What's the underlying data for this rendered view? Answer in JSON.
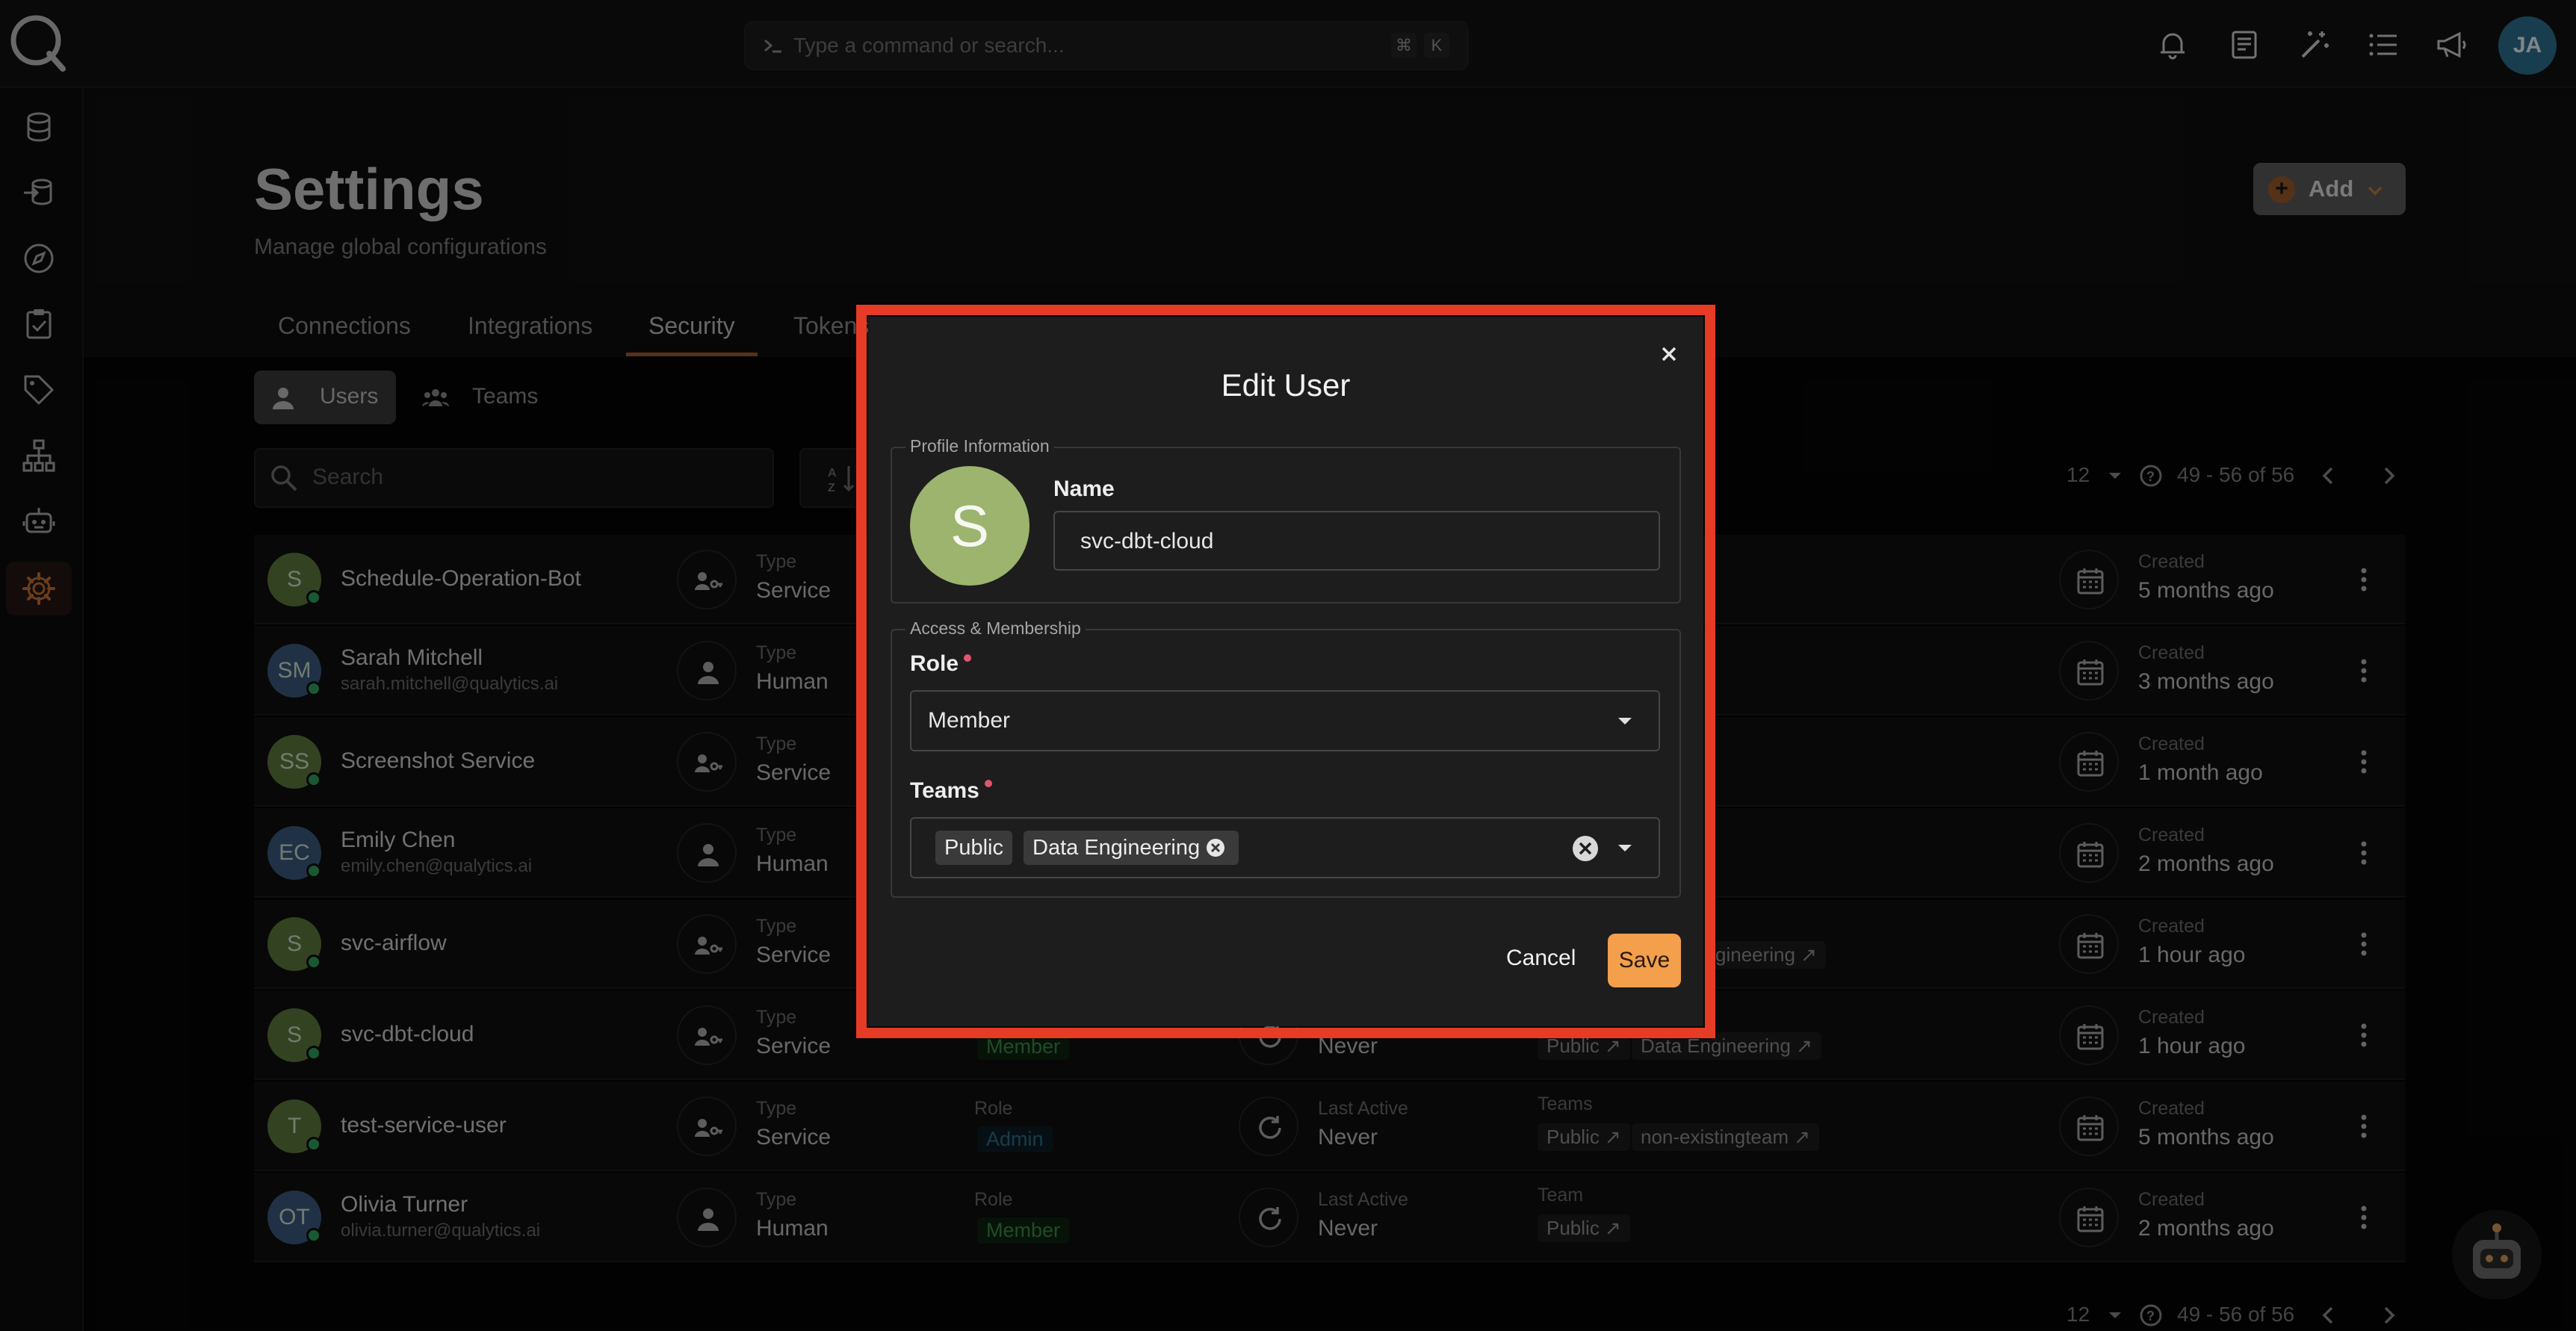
{
  "topbar": {
    "command_placeholder": "Type a command or search...",
    "shortcut_keys": [
      "⌘",
      "K"
    ],
    "avatar_initials": "JA"
  },
  "page": {
    "title": "Settings",
    "subtitle": "Manage global configurations",
    "add_label": "Add"
  },
  "tabs": [
    {
      "label": "Connections"
    },
    {
      "label": "Integrations"
    },
    {
      "label": "Security",
      "active": true
    },
    {
      "label": "Tokens"
    }
  ],
  "segments": [
    {
      "label": "Users",
      "active": true
    },
    {
      "label": "Teams"
    }
  ],
  "search": {
    "placeholder": "Search"
  },
  "pagination": {
    "page_size": "12",
    "range": "49 - 56 of 56"
  },
  "users": [
    {
      "initials": "S",
      "name": "Schedule-Operation-Bot",
      "email": "",
      "type_label": "Type",
      "type": "Service",
      "created_label": "Created",
      "created": "5 months ago",
      "avatar_color": "#5e7a3c"
    },
    {
      "initials": "SM",
      "name": "Sarah Mitchell",
      "email": "sarah.mitchell@qualytics.ai",
      "type_label": "Type",
      "type": "Human",
      "created_label": "Created",
      "created": "3 months ago",
      "avatar_color": "#3b5a7e"
    },
    {
      "initials": "SS",
      "name": "Screenshot Service",
      "email": "",
      "type_label": "Type",
      "type": "Service",
      "created_label": "Created",
      "created": "1 month ago",
      "avatar_color": "#5e7a3c"
    },
    {
      "initials": "EC",
      "name": "Emily Chen",
      "email": "emily.chen@qualytics.ai",
      "type_label": "Type",
      "type": "Human",
      "created_label": "Created",
      "created": "2 months ago",
      "avatar_color": "#3b5a7e"
    },
    {
      "initials": "S",
      "name": "svc-airflow",
      "email": "",
      "type_label": "Type",
      "type": "Service",
      "created_label": "Created",
      "created": "1 hour ago",
      "avatar_color": "#5e7a3c",
      "teams_partial": "gineering"
    },
    {
      "initials": "S",
      "name": "svc-dbt-cloud",
      "email": "",
      "type_label": "Type",
      "type": "Service",
      "role": "Member",
      "last_active": "Never",
      "teams": [
        "Public",
        "Data Engineering"
      ],
      "created_label": "Created",
      "created": "1 hour ago",
      "avatar_color": "#5e7a3c"
    },
    {
      "initials": "T",
      "name": "test-service-user",
      "email": "",
      "type_label": "Type",
      "type": "Service",
      "role_label": "Role",
      "role": "Admin",
      "last_active_label": "Last Active",
      "last_active": "Never",
      "teams_label": "Teams",
      "teams": [
        "Public",
        "non-existingteam"
      ],
      "created_label": "Created",
      "created": "5 months ago",
      "avatar_color": "#5e7a3c"
    },
    {
      "initials": "OT",
      "name": "Olivia Turner",
      "email": "olivia.turner@qualytics.ai",
      "type_label": "Type",
      "type": "Human",
      "role_label": "Role",
      "role": "Member",
      "last_active_label": "Last Active",
      "last_active": "Never",
      "teams_label": "Team",
      "teams": [
        "Public"
      ],
      "created_label": "Created",
      "created": "2 months ago",
      "avatar_color": "#3b5a7e"
    }
  ],
  "modal": {
    "title": "Edit User",
    "profile_legend": "Profile Information",
    "avatar_initial": "S",
    "name_label": "Name",
    "name_value": "svc-dbt-cloud",
    "access_legend": "Access & Membership",
    "role_label": "Role",
    "role_value": "Member",
    "teams_label": "Teams",
    "teams": [
      "Public",
      "Data Engineering"
    ],
    "cancel_label": "Cancel",
    "save_label": "Save"
  },
  "colors": {
    "accent": "#f39f4b",
    "highlight": "#e63b24",
    "status_online": "#2ca35d",
    "required": "#e0556d"
  }
}
